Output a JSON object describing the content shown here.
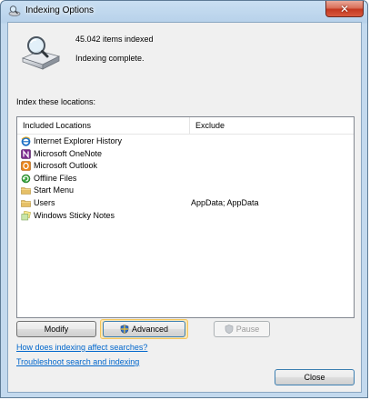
{
  "window": {
    "title": "Indexing Options",
    "close_glyph": "✕"
  },
  "summary": {
    "items_indexed": "45.042 items indexed",
    "status": "Indexing complete."
  },
  "locations": {
    "heading": "Index these locations:",
    "columns": {
      "included": "Included Locations",
      "exclude": "Exclude"
    },
    "rows": [
      {
        "label": "Internet Explorer History",
        "exclude": "",
        "icon": "internet-explorer-icon"
      },
      {
        "label": "Microsoft OneNote",
        "exclude": "",
        "icon": "onenote-icon"
      },
      {
        "label": "Microsoft Outlook",
        "exclude": "",
        "icon": "outlook-icon"
      },
      {
        "label": "Offline Files",
        "exclude": "",
        "icon": "offline-files-icon"
      },
      {
        "label": "Start Menu",
        "exclude": "",
        "icon": "folder-icon"
      },
      {
        "label": "Users",
        "exclude": "AppData; AppData",
        "icon": "folder-icon"
      },
      {
        "label": "Windows Sticky Notes",
        "exclude": "",
        "icon": "sticky-notes-icon"
      }
    ]
  },
  "buttons": {
    "modify": "Modify",
    "advanced": "Advanced",
    "pause": "Pause",
    "close": "Close"
  },
  "links": {
    "how_indexing": "How does indexing affect searches?",
    "troubleshoot": "Troubleshoot search and indexing"
  },
  "colors": {
    "link": "#0066cc",
    "onenote": "#7b2a8e",
    "outlook": "#e8841a",
    "folder": "#e6c067",
    "ie": "#1d6fc4"
  }
}
